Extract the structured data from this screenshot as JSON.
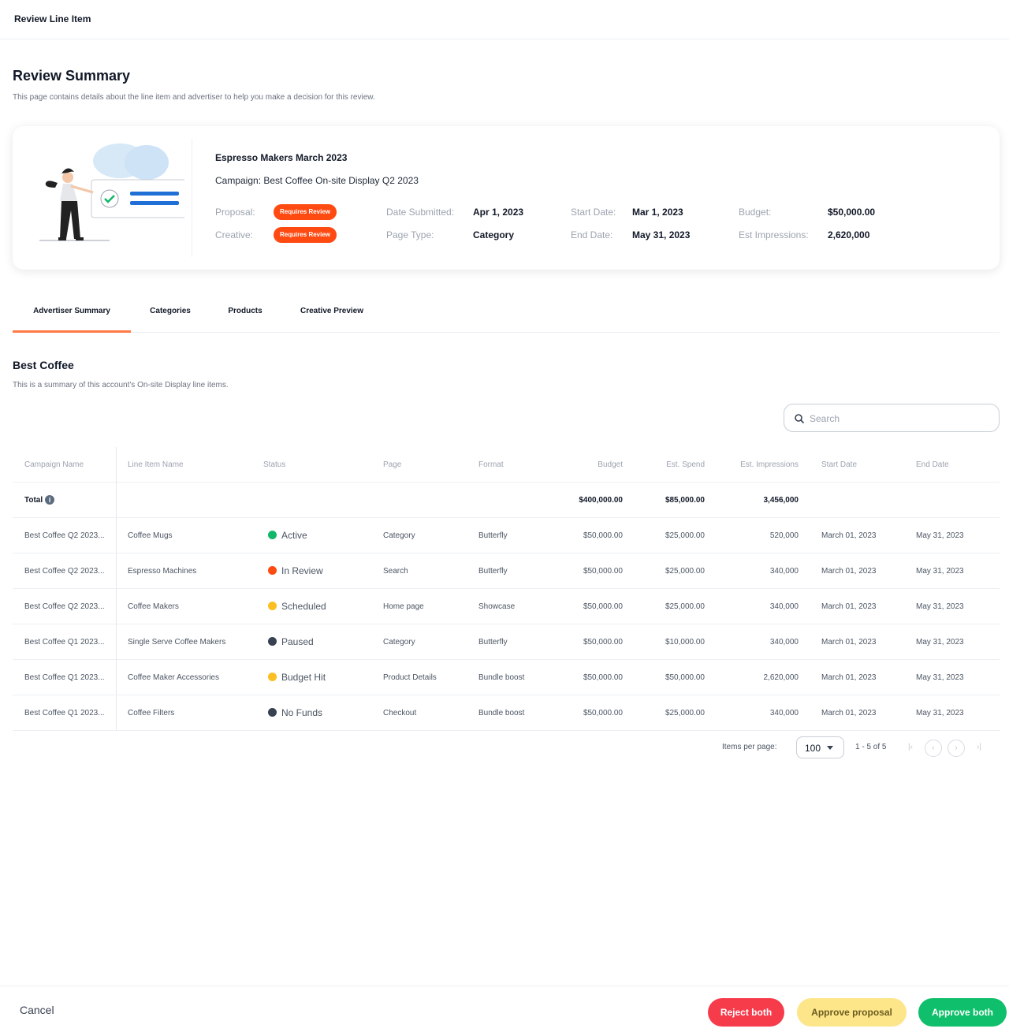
{
  "header": {
    "title": "Review Line Item"
  },
  "summary": {
    "title": "Review Summary",
    "subtitle": "This page contains details about the line item and advertiser to help you make a decision for this review."
  },
  "card": {
    "line_item_name": "Espresso Makers March 2023",
    "campaign": "Campaign: Best Coffee On-site Display Q2 2023",
    "proposal_label": "Proposal:",
    "proposal_badge": "Requires Review",
    "creative_label": "Creative:",
    "creative_badge": "Requires Review",
    "date_submitted_label": "Date Submitted:",
    "date_submitted": "Apr 1, 2023",
    "page_type_label": "Page Type:",
    "page_type": "Category",
    "start_date_label": "Start Date:",
    "start_date": "Mar 1, 2023",
    "end_date_label": "End Date:",
    "end_date": "May 31, 2023",
    "budget_label": "Budget:",
    "budget": "$50,000.00",
    "impressions_label": "Est Impressions:",
    "impressions": "2,620,000"
  },
  "tabs": [
    {
      "label": "Advertiser Summary",
      "active": true
    },
    {
      "label": "Categories",
      "active": false
    },
    {
      "label": "Products",
      "active": false
    },
    {
      "label": "Creative Preview",
      "active": false
    }
  ],
  "advertiser": {
    "name": "Best Coffee",
    "subtitle": "This is a summary of this account's On-site Display line items."
  },
  "search": {
    "placeholder": "Search",
    "value": ""
  },
  "table": {
    "columns": [
      "Campaign Name",
      "Line Item Name",
      "Status",
      "Page",
      "Format",
      "Budget",
      "Est. Spend",
      "Est. Impressions",
      "Start Date",
      "End Date"
    ],
    "total": {
      "label": "Total",
      "budget": "$400,000.00",
      "spend": "$85,000.00",
      "impressions": "3,456,000"
    },
    "rows": [
      {
        "campaign": "Best Coffee Q2 2023...",
        "line_item": "Coffee Mugs",
        "status": "Active",
        "status_color": "#12b76a",
        "page": "Category",
        "format": "Butterfly",
        "budget": "$50,000.00",
        "spend": "$25,000.00",
        "impressions": "520,000",
        "start": "March 01, 2023",
        "end": "May 31, 2023"
      },
      {
        "campaign": "Best Coffee Q2 2023...",
        "line_item": "Espresso Machines",
        "status": "In Review",
        "status_color": "#ff4a12",
        "page": "Search",
        "format": "Butterfly",
        "budget": "$50,000.00",
        "spend": "$25,000.00",
        "impressions": "340,000",
        "start": "March 01, 2023",
        "end": "May 31, 2023"
      },
      {
        "campaign": "Best Coffee Q2 2023...",
        "line_item": "Coffee Makers",
        "status": "Scheduled",
        "status_color": "#fbbf24",
        "page": "Home page",
        "format": "Showcase",
        "budget": "$50,000.00",
        "spend": "$25,000.00",
        "impressions": "340,000",
        "start": "March 01, 2023",
        "end": "May 31, 2023"
      },
      {
        "campaign": "Best Coffee Q1 2023...",
        "line_item": "Single Serve Coffee Makers",
        "status": "Paused",
        "status_color": "#374151",
        "page": "Category",
        "format": "Butterfly",
        "budget": "$50,000.00",
        "spend": "$10,000.00",
        "impressions": "340,000",
        "start": "March 01, 2023",
        "end": "May 31, 2023"
      },
      {
        "campaign": "Best Coffee Q1 2023...",
        "line_item": "Coffee Maker Accessories",
        "status": "Budget Hit",
        "status_color": "#fbbf24",
        "page": "Product Details",
        "format": "Bundle boost",
        "budget": "$50,000.00",
        "spend": "$50,000.00",
        "impressions": "2,620,000",
        "start": "March 01, 2023",
        "end": "May 31, 2023"
      },
      {
        "campaign": "Best Coffee Q1 2023...",
        "line_item": "Coffee Filters",
        "status": "No Funds",
        "status_color": "#374151",
        "page": "Checkout",
        "format": "Bundle boost",
        "budget": "$50,000.00",
        "spend": "$25,000.00",
        "impressions": "340,000",
        "start": "March 01, 2023",
        "end": "May 31, 2023"
      }
    ]
  },
  "pagination": {
    "items_per_page_label": "Items per page:",
    "items_per_page": "100",
    "range": "1 - 5 of 5"
  },
  "footer": {
    "cancel": "Cancel",
    "reject": "Reject both",
    "approve_proposal": "Approve proposal",
    "approve_both": "Approve both"
  }
}
